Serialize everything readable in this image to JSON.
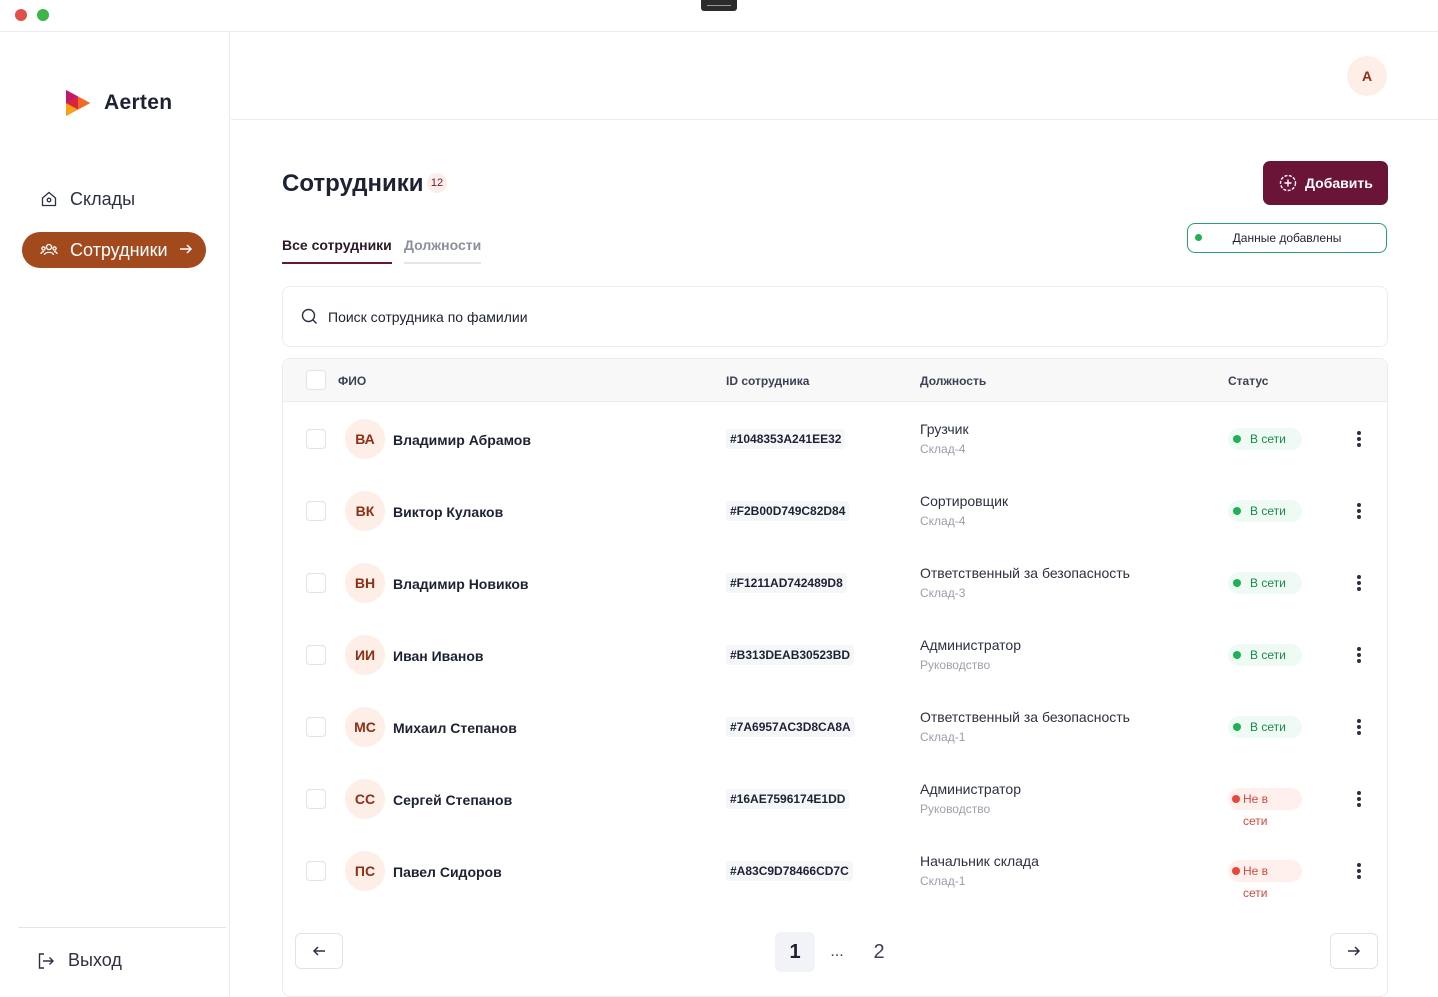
{
  "app": {
    "logo_text": "Aerten",
    "user_initial": "A"
  },
  "sidebar": {
    "items": [
      {
        "label": "Склады",
        "icon": "home-icon"
      },
      {
        "label": "Сотрудники",
        "icon": "users-icon"
      }
    ],
    "logout_label": "Выход"
  },
  "page": {
    "title": "Сотрудники",
    "count": "12",
    "add_button_label": "Добавить",
    "toast_text": "Данные добавлены",
    "tabs": [
      {
        "label": "Все сотрудники",
        "active": true
      },
      {
        "label": "Должности",
        "active": false
      }
    ],
    "search_placeholder": "Поиск сотрудника по фамилии"
  },
  "table": {
    "columns": [
      "ФИО",
      "ID сотрудника",
      "Должность",
      "Статус"
    ],
    "rows": [
      {
        "initials": "ВА",
        "name": "Владимир Абрамов",
        "id": "#1048353A241EE32",
        "position": "Грузчик",
        "location": "Склад-4",
        "status": "В сети",
        "online": true
      },
      {
        "initials": "ВК",
        "name": "Виктор Кулаков",
        "id": "#F2B00D749C82D84",
        "position": "Сортировщик",
        "location": "Склад-4",
        "status": "В сети",
        "online": true
      },
      {
        "initials": "ВН",
        "name": "Владимир Новиков",
        "id": "#F1211AD742489D8",
        "position": "Ответственный за безопасность",
        "location": "Склад-3",
        "status": "В сети",
        "online": true
      },
      {
        "initials": "ИИ",
        "name": "Иван Иванов",
        "id": "#B313DEAB30523BD",
        "position": "Администратор",
        "location": "Руководство",
        "status": "В сети",
        "online": true
      },
      {
        "initials": "МС",
        "name": "Михаил Степанов",
        "id": "#7A6957AC3D8CA8A",
        "position": "Ответственный за безопасность",
        "location": "Склад-1",
        "status": "В сети",
        "online": true
      },
      {
        "initials": "СС",
        "name": "Сергей Степанов",
        "id": "#16AE7596174E1DD",
        "position": "Администратор",
        "location": "Руководство",
        "status": "Не в сети",
        "online": false
      },
      {
        "initials": "ПС",
        "name": "Павел Сидоров",
        "id": "#A83C9D78466CD7C",
        "position": "Начальник склада",
        "location": "Склад-1",
        "status": "Не в сети",
        "online": false
      }
    ]
  },
  "pagination": {
    "current": "1",
    "ellipsis": "...",
    "next_page": "2"
  },
  "colors": {
    "accent": "#6a1537",
    "nav_active": "#a24a1e",
    "online": "#1fb157",
    "offline": "#e8473b"
  }
}
